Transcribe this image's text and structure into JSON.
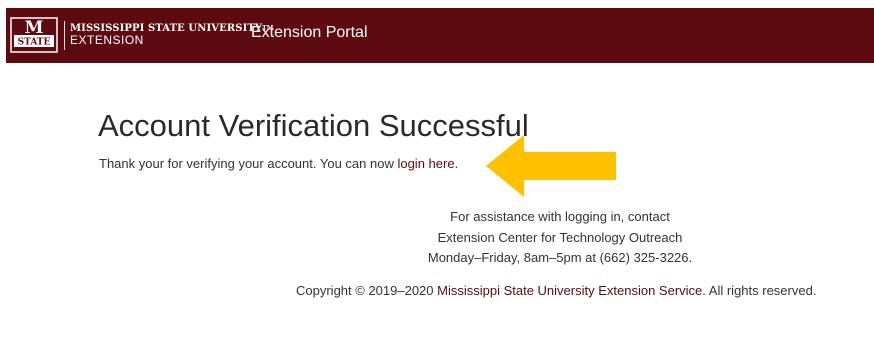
{
  "header": {
    "logo_icon": "msu-state-logo-icon",
    "logo_letter": "M",
    "logo_banner": "STATE",
    "university_name": "MISSISSIPPI STATE UNIVERSITY",
    "trademark": "TM",
    "division": "EXTENSION",
    "portal_name": "Extension Portal"
  },
  "main": {
    "title": "Account Verification Successful",
    "message_prefix": "Thank your for verifying your account. You can now ",
    "login_link_text": "login here",
    "message_suffix": ".",
    "arrow_icon": "left-arrow-icon"
  },
  "assistance": {
    "line1": "For assistance with logging in, contact",
    "line2": "Extension Center for Technology Outreach",
    "line3": "Monday–Friday, 8am–5pm at (662) 325-3226."
  },
  "footer": {
    "copyright_prefix": "Copyright © 2019–2020 ",
    "copyright_link_text": "Mississippi State University Extension Service",
    "copyright_suffix": ". All rights reserved."
  },
  "colors": {
    "brand_maroon": "#5d0a10",
    "arrow_yellow": "#ffc000",
    "text": "#333333",
    "background": "#ffffff"
  }
}
